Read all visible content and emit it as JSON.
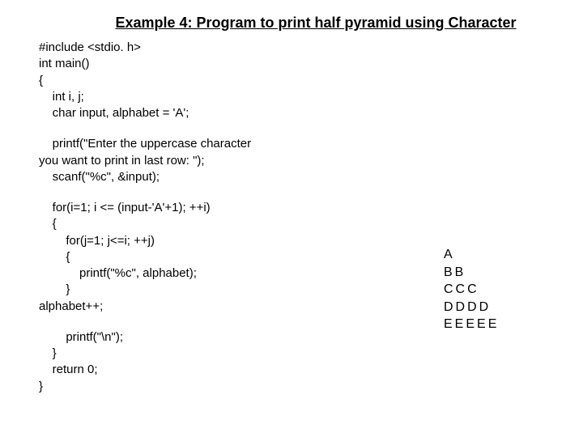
{
  "title": "Example 4: Program to print half pyramid using Character",
  "code": {
    "l1": "#include <stdio. h>",
    "l2": "int main()",
    "l3": "{",
    "l4": "    int i, j;",
    "l5": "    char input, alphabet = 'A';",
    "l6": "    printf(\"Enter the uppercase character",
    "l7": "you want to print in last row: \");",
    "l8": "    scanf(\"%c\", &input);",
    "l9": "    for(i=1; i <= (input-'A'+1); ++i)",
    "l10": "    {",
    "l11": "        for(j=1; j<=i; ++j)",
    "l12": "        {",
    "l13": "            printf(\"%c\", alphabet);",
    "l14": "        }",
    "l15": "alphabet++;",
    "l16": "        printf(\"\\n\");",
    "l17": "    }",
    "l18": "    return 0;",
    "l19": "}"
  },
  "output": {
    "r1": "A",
    "r2": "BB",
    "r3": "CCC",
    "r4": "DDDD",
    "r5": "EEEEE"
  }
}
